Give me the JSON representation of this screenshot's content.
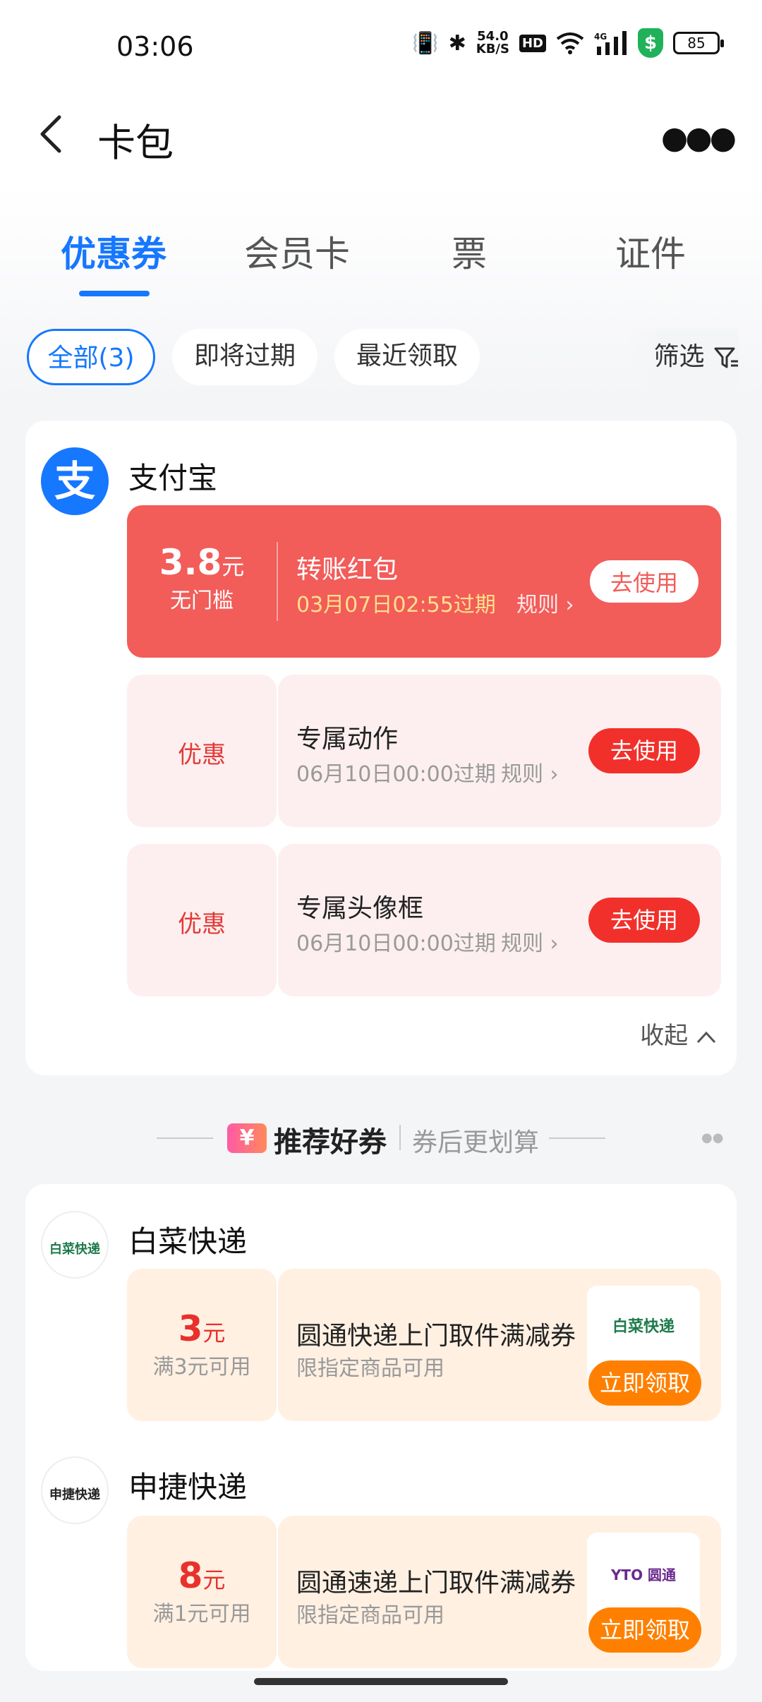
{
  "status": {
    "time": "03:06",
    "speed_value": "54.0",
    "speed_unit": "KB/S",
    "hd": "HD",
    "net": "4G",
    "battery": "85"
  },
  "nav": {
    "title": "卡包"
  },
  "tabs": [
    {
      "label": "优惠券"
    },
    {
      "label": "会员卡"
    },
    {
      "label": "票"
    },
    {
      "label": "证件"
    }
  ],
  "filters": {
    "all": "全部(3)",
    "expiring": "即将过期",
    "recent": "最近领取",
    "filter": "筛选"
  },
  "alipay": {
    "brand": "支付宝",
    "logo_char": "支",
    "coupons": [
      {
        "amount": "3.8",
        "unit": "元",
        "condition": "无门槛",
        "name": "转账红包",
        "expire": "03月07日02:55过期",
        "rule": "规则",
        "action": "去使用"
      },
      {
        "tag": "优惠",
        "name": "专属动作",
        "expire": "06月10日00:00过期",
        "rule": "规则",
        "action": "去使用"
      },
      {
        "tag": "优惠",
        "name": "专属头像框",
        "expire": "06月10日00:00过期",
        "rule": "规则",
        "action": "去使用"
      }
    ],
    "collapse": "收起"
  },
  "recommend": {
    "title": "推荐好券",
    "subtitle": "券后更划算",
    "badge": "¥"
  },
  "baicai": {
    "brand": "白菜快递",
    "logo_text": "白菜快递",
    "coupon": {
      "amount": "3",
      "unit": "元",
      "condition": "满3元可用",
      "name": "圆通快递上门取件满减券",
      "desc": "限指定商品可用",
      "thumb_text": "白菜快递",
      "action": "立即领取"
    }
  },
  "shenjie": {
    "brand": "申捷快递",
    "logo_text": "申捷快递",
    "coupon": {
      "amount": "8",
      "unit": "元",
      "condition": "满1元可用",
      "name": "圆通速递上门取件满减券",
      "desc": "限指定商品可用",
      "thumb_text": "YTO 圆通",
      "action": "立即领取"
    }
  },
  "colors": {
    "accent": "#1677ff",
    "red": "#f25c59",
    "orange": "#ff8000"
  }
}
